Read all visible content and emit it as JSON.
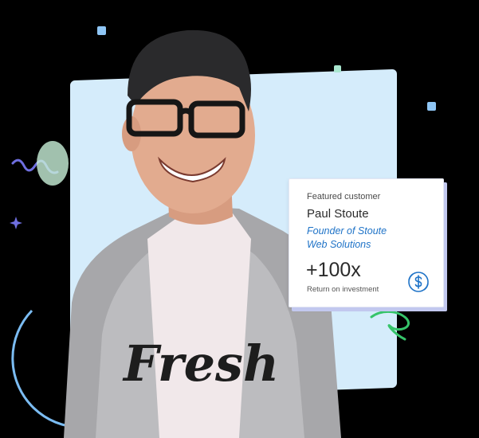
{
  "card": {
    "eyebrow": "Featured customer",
    "name": "Paul Stoute",
    "role_line1": "Founder of Stoute",
    "role_line2": "Web Solutions",
    "metric": "+100x",
    "metric_label": "Return on investment",
    "icon": "dollar-circle-icon"
  },
  "photo": {
    "shirt_text": "Fresh"
  },
  "colors": {
    "panel": "#d5ecfb",
    "accent_blue": "#1f73c7",
    "card_shadow": "#c2c8ef",
    "deco_green": "#36c46a",
    "deco_purple": "#6f6fe0",
    "deco_blue": "#7bbcf2"
  }
}
